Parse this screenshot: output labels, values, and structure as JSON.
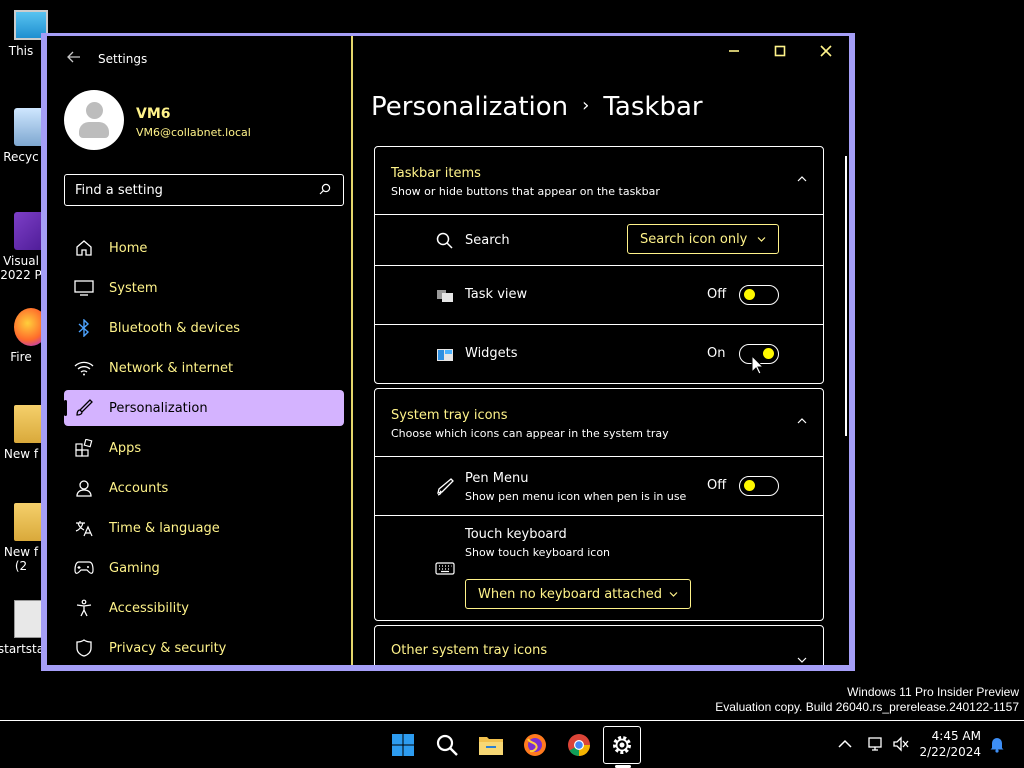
{
  "desktop": {
    "icons": [
      {
        "label": "This",
        "icon": "this-pc-icon"
      },
      {
        "label": "Recyc",
        "icon": "recycle-bin-icon"
      },
      {
        "label": "Visual\n2022 P",
        "icon": "visual-studio-icon"
      },
      {
        "label": "Fire",
        "icon": "firefox-icon"
      },
      {
        "label": "New f",
        "icon": "folder-icon"
      },
      {
        "label": "New f\n(2",
        "icon": "folder-icon"
      },
      {
        "label": "startsta",
        "icon": "file-icon"
      }
    ],
    "watermark": {
      "line1": "Windows 11 Pro Insider Preview",
      "line2": "Evaluation copy. Build 26040.rs_prerelease.240122-1157"
    }
  },
  "window": {
    "app_title": "Settings",
    "caption": {
      "minimize": "—",
      "maximize": "☐",
      "close": "✕"
    },
    "user": {
      "name": "VM6",
      "email": "VM6@collabnet.local"
    },
    "search": {
      "placeholder": "Find a setting"
    },
    "nav": [
      {
        "label": "Home",
        "icon": "home-icon"
      },
      {
        "label": "System",
        "icon": "system-icon"
      },
      {
        "label": "Bluetooth & devices",
        "icon": "bluetooth-icon"
      },
      {
        "label": "Network & internet",
        "icon": "network-icon"
      },
      {
        "label": "Personalization",
        "icon": "personalization-icon",
        "active": true
      },
      {
        "label": "Apps",
        "icon": "apps-icon"
      },
      {
        "label": "Accounts",
        "icon": "accounts-icon"
      },
      {
        "label": "Time & language",
        "icon": "time-language-icon"
      },
      {
        "label": "Gaming",
        "icon": "gaming-icon"
      },
      {
        "label": "Accessibility",
        "icon": "accessibility-icon"
      },
      {
        "label": "Privacy & security",
        "icon": "privacy-icon"
      }
    ],
    "heading": {
      "parent": "Personalization",
      "separator": "›",
      "current": "Taskbar"
    },
    "sections": {
      "taskbar_items": {
        "title": "Taskbar items",
        "subtitle": "Show or hide buttons that appear on the taskbar",
        "search": {
          "label": "Search",
          "value": "Search icon only"
        },
        "task_view": {
          "label": "Task view",
          "state": "Off"
        },
        "widgets": {
          "label": "Widgets",
          "state": "On"
        }
      },
      "system_tray": {
        "title": "System tray icons",
        "subtitle": "Choose which icons can appear in the system tray",
        "pen_menu": {
          "label": "Pen Menu",
          "desc": "Show pen menu icon when pen is in use",
          "state": "Off"
        },
        "touch_keyboard": {
          "label": "Touch keyboard",
          "desc": "Show touch keyboard icon",
          "value": "When no keyboard attached"
        }
      },
      "other_tray": {
        "title": "Other system tray icons"
      }
    }
  },
  "taskbar": {
    "apps": [
      "start-icon",
      "search-icon",
      "file-explorer-icon",
      "firefox-icon",
      "chrome-icon",
      "settings-icon"
    ],
    "time": "4:45 AM",
    "date": "2/22/2024"
  },
  "colors": {
    "accent_text": "#fff38a",
    "selected_nav": "#d4b3ff",
    "window_border": "#a59ef7",
    "toggle_knob": "#fff900"
  }
}
